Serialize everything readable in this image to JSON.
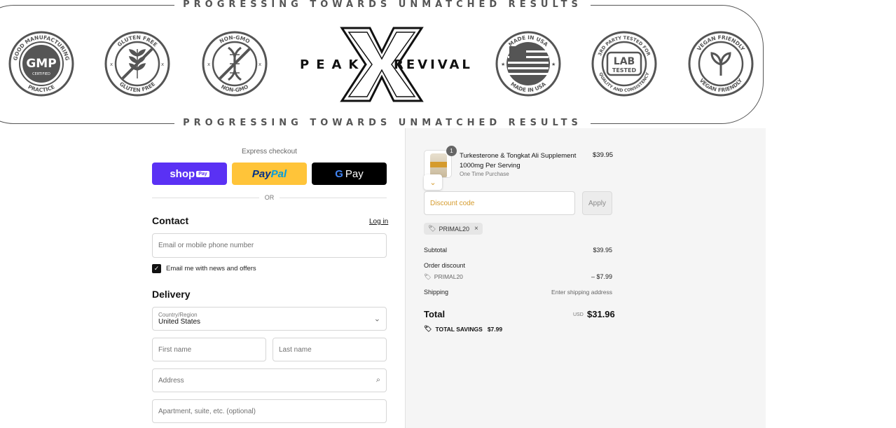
{
  "banner": {
    "tagline": "PROGRESSING   TOWARDS   UNMATCHED   RESULTS",
    "logo_left": "PEAK",
    "logo_right": "REVIVAL",
    "badges": [
      {
        "name": "gmp-badge",
        "top": "GOOD MANUFACTURING",
        "center": "GMP",
        "center_small": "CERTIFIED",
        "bottom": "PRACTICE"
      },
      {
        "name": "gluten-free-badge",
        "top": "GLUTEN FREE",
        "bottom": "GLUTEN FREE"
      },
      {
        "name": "non-gmo-badge",
        "top": "NON-GMO",
        "bottom": "NON-GMO"
      },
      {
        "name": "made-in-usa-badge",
        "top": "MADE IN USA",
        "bottom": "MADE IN USA"
      },
      {
        "name": "lab-tested-badge",
        "top": "3RD PARTY TESTED FOR",
        "center": "LAB",
        "center_small": "TESTED",
        "bottom": "QUALITY AND CONSISTENCY"
      },
      {
        "name": "vegan-badge",
        "top": "VEGAN FRIENDLY",
        "bottom": "VEGAN FRIENDLY"
      }
    ]
  },
  "checkout": {
    "express_label": "Express checkout",
    "shop_pay": "shop",
    "shop_pay_tag": "Pay",
    "paypal_1": "Pay",
    "paypal_2": "Pal",
    "gpay_g": "G",
    "gpay_text": "Pay",
    "or_label": "OR",
    "contact_heading": "Contact",
    "login_link": "Log in",
    "email_placeholder": "Email or mobile phone number",
    "newsletter_label": "Email me with news and offers",
    "delivery_heading": "Delivery",
    "country_label": "Country/Region",
    "country_value": "United States",
    "first_name_placeholder": "First name",
    "last_name_placeholder": "Last name",
    "address_placeholder": "Address",
    "apartment_placeholder": "Apartment, suite, etc. (optional)"
  },
  "summary": {
    "qty": "1",
    "product_title": "Turkesterone & Tongkat Ali Supplement 1000mg Per Serving",
    "product_sub": "One Time Purchase",
    "product_price": "$39.95",
    "discount_placeholder": "Discount code",
    "apply_label": "Apply",
    "applied_code": "PRIMAL20",
    "subtotal_label": "Subtotal",
    "subtotal_value": "$39.95",
    "order_discount_label": "Order discount",
    "discount_code": "PRIMAL20",
    "discount_value": "– $7.99",
    "shipping_label": "Shipping",
    "shipping_value": "Enter shipping address",
    "total_label": "Total",
    "currency": "USD",
    "total_value": "$31.96",
    "savings_label": "TOTAL SAVINGS",
    "savings_value": "$7.99"
  },
  "colors": {
    "shop_pay": "#5a31f4",
    "paypal": "#ffc439",
    "accent": "#d59b2d"
  }
}
